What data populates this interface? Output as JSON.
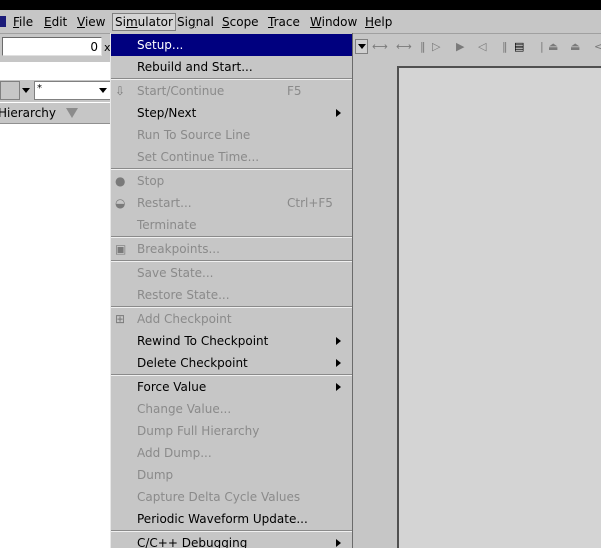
{
  "menubar": {
    "items": [
      {
        "label": "File",
        "u": "F"
      },
      {
        "label": "Edit",
        "u": "E"
      },
      {
        "label": "View",
        "u": "V"
      },
      {
        "label": "Simulator",
        "u": "m"
      },
      {
        "label": "Signal",
        "u": "g"
      },
      {
        "label": "Scope",
        "u": "S"
      },
      {
        "label": "Trace",
        "u": "T"
      },
      {
        "label": "Window",
        "u": "W"
      },
      {
        "label": "Help",
        "u": "H"
      }
    ]
  },
  "toolbar": {
    "time_value": "0",
    "suffix": "x"
  },
  "leftpane": {
    "filter_value": "*",
    "hierarchy_label": "Hierarchy"
  },
  "simulator_menu": {
    "items": [
      {
        "label": "Setup...",
        "shortcut": "",
        "submenu": false,
        "disabled": false,
        "selected": true
      },
      {
        "label": "Rebuild and Start...",
        "shortcut": "",
        "submenu": false,
        "disabled": false
      },
      {
        "label": "Start/Continue",
        "shortcut": "F5",
        "submenu": false,
        "disabled": true,
        "icon": "down-arrow-icon"
      },
      {
        "label": "Step/Next",
        "shortcut": "",
        "submenu": true,
        "disabled": false
      },
      {
        "label": "Run To Source Line",
        "shortcut": "",
        "submenu": false,
        "disabled": true
      },
      {
        "label": "Set Continue Time...",
        "shortcut": "",
        "submenu": false,
        "disabled": true
      },
      {
        "label": "Stop",
        "shortcut": "",
        "submenu": false,
        "disabled": true,
        "icon": "stop-circle-icon"
      },
      {
        "label": "Restart...",
        "shortcut": "Ctrl+F5",
        "submenu": false,
        "disabled": true,
        "icon": "restart-icon"
      },
      {
        "label": "Terminate",
        "shortcut": "",
        "submenu": false,
        "disabled": true
      },
      {
        "label": "Breakpoints...",
        "shortcut": "",
        "submenu": false,
        "disabled": true,
        "icon": "breakpoint-icon"
      },
      {
        "label": "Save State...",
        "shortcut": "",
        "submenu": false,
        "disabled": true
      },
      {
        "label": "Restore State...",
        "shortcut": "",
        "submenu": false,
        "disabled": true
      },
      {
        "label": "Add Checkpoint",
        "shortcut": "",
        "submenu": false,
        "disabled": true,
        "icon": "checkpoint-icon"
      },
      {
        "label": "Rewind To Checkpoint",
        "shortcut": "",
        "submenu": true,
        "disabled": false
      },
      {
        "label": "Delete Checkpoint",
        "shortcut": "",
        "submenu": true,
        "disabled": false
      },
      {
        "label": "Force Value",
        "shortcut": "",
        "submenu": true,
        "disabled": false
      },
      {
        "label": "Change Value...",
        "shortcut": "",
        "submenu": false,
        "disabled": true
      },
      {
        "label": "Dump Full Hierarchy",
        "shortcut": "",
        "submenu": false,
        "disabled": true
      },
      {
        "label": "Add Dump...",
        "shortcut": "",
        "submenu": false,
        "disabled": true
      },
      {
        "label": "Dump",
        "shortcut": "",
        "submenu": false,
        "disabled": true
      },
      {
        "label": "Capture Delta Cycle Values",
        "shortcut": "",
        "submenu": false,
        "disabled": true
      },
      {
        "label": "Periodic Waveform Update...",
        "shortcut": "",
        "submenu": false,
        "disabled": false
      },
      {
        "label": "C/C++ Debugging",
        "shortcut": "",
        "submenu": true,
        "disabled": false
      }
    ]
  },
  "colors": {
    "menu_bg": "#c6c6c6",
    "selection": "#00007f",
    "disabled_text": "#8a8a8a"
  }
}
